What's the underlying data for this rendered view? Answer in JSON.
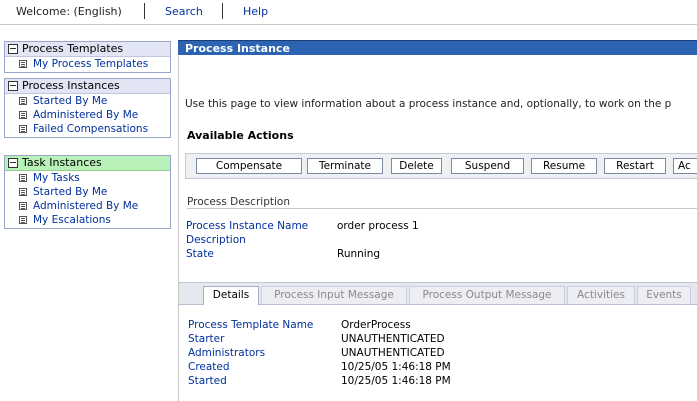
{
  "topbar": {
    "welcome": "Welcome: (English)",
    "search": "Search",
    "help": "Help"
  },
  "nav": {
    "process_templates": {
      "title": "Process Templates",
      "items": [
        "My Process Templates"
      ]
    },
    "process_instances": {
      "title": "Process Instances",
      "items": [
        "Started By Me",
        "Administered By Me",
        "Failed Compensations"
      ]
    },
    "task_instances": {
      "title": "Task Instances",
      "items": [
        "My Tasks",
        "Started By Me",
        "Administered By Me",
        "My Escalations"
      ]
    }
  },
  "main": {
    "title": "Process Instance",
    "intro": "Use this page to view information about a process instance and, optionally, to work on the p",
    "actions_title": "Available Actions",
    "actions": [
      "Compensate",
      "Terminate",
      "Delete",
      "Suspend",
      "Resume",
      "Restart",
      "Ac"
    ],
    "description_section": "Process Description",
    "fields": [
      {
        "label": "Process Instance Name",
        "value": "order process 1"
      },
      {
        "label": "Description",
        "value": ""
      },
      {
        "label": "State",
        "value": "Running"
      }
    ],
    "tabs": [
      "Details",
      "Process Input Message",
      "Process Output Message",
      "Activities",
      "Events"
    ],
    "details": [
      {
        "label": "Process Template Name",
        "value": "OrderProcess"
      },
      {
        "label": "Starter",
        "value": "UNAUTHENTICATED"
      },
      {
        "label": "Administrators",
        "value": "UNAUTHENTICATED"
      },
      {
        "label": "Created",
        "value": "10/25/05 1:46:18 PM"
      },
      {
        "label": "Started",
        "value": "10/25/05 1:46:18 PM"
      }
    ]
  },
  "colors": {
    "title_bar": "#2c64b2",
    "link": "#00309c",
    "task_header": "#b9f2b9",
    "nav_header": "#e2e5f4"
  }
}
